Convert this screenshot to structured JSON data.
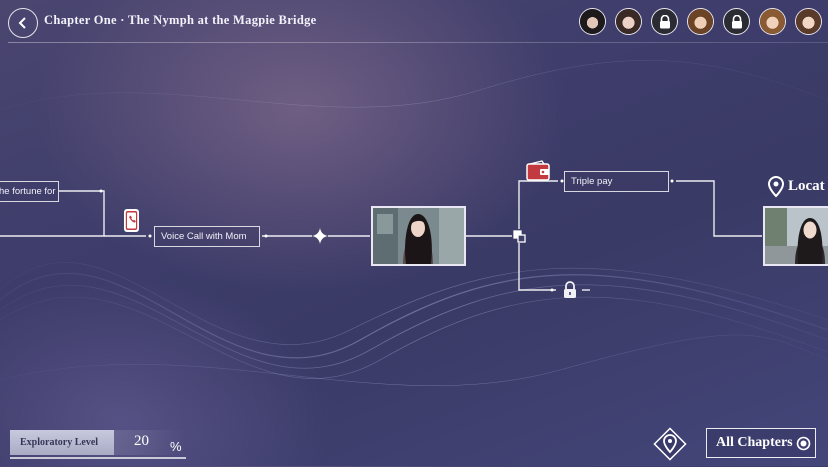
{
  "header": {
    "title": "Chapter One · The Nymph at the Magpie Bridge",
    "avatars": [
      {
        "state": "unlocked",
        "hair": "#1e1a1c",
        "skin": "#e4c6b8"
      },
      {
        "state": "unlocked",
        "hair": "#3a2a26",
        "skin": "#ecd2c6"
      },
      {
        "state": "locked"
      },
      {
        "state": "unlocked",
        "hair": "#6b4326",
        "skin": "#efcfb8"
      },
      {
        "state": "locked"
      },
      {
        "state": "unlocked",
        "hair": "#8a5a32",
        "skin": "#f0d2bc"
      },
      {
        "state": "unlocked",
        "hair": "#5a3a28",
        "skin": "#f2d6c6"
      }
    ]
  },
  "story_map": {
    "node_fortune": "he fortune for Buddha",
    "node_voice_call": "Voice Call with Mom",
    "node_triple_pay": "Triple pay",
    "location_label": "Locat",
    "icons": [
      "phone-icon",
      "wallet-icon",
      "lock-icon",
      "branch-icon",
      "sparkle-icon",
      "location-pin-icon"
    ]
  },
  "footer": {
    "exploratory_label": "Exploratory Level",
    "exploratory_value": "20",
    "exploratory_unit": "%",
    "all_chapters_label": "All Chapters"
  },
  "colors": {
    "accent_red": "#c23a3f",
    "line": "#ffffff",
    "panel": "#b9bbd2"
  }
}
